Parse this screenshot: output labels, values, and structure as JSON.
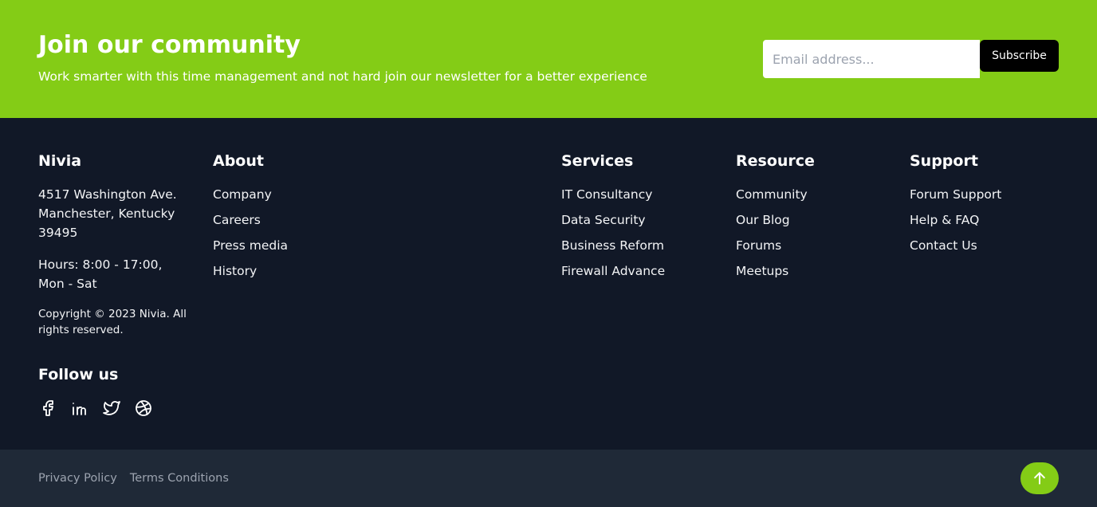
{
  "newsletter": {
    "title": "Join our community",
    "subtitle": "Work smarter with this time management and not hard join our newsletter for a better experience",
    "email_placeholder": "Email address...",
    "subscribe_label": "Subscribe"
  },
  "brand": {
    "name": "Nivia",
    "address_line1": "4517 Washington Ave.",
    "address_line2": "Manchester, Kentucky",
    "address_line3": "39495",
    "hours_line1": "Hours: 8:00 - 17:00,",
    "hours_line2": "Mon - Sat",
    "copyright": "Copyright © 2023 Nivia. All rights reserved.",
    "follow_title": "Follow us",
    "socials": [
      "facebook-icon",
      "linkedin-icon",
      "twitter-icon",
      "dribbble-icon"
    ]
  },
  "columns": {
    "about": {
      "title": "About",
      "links": [
        "Company",
        "Careers",
        "Press media",
        "History"
      ]
    },
    "services": {
      "title": "Services",
      "links": [
        "IT Consultancy",
        "Data Security",
        "Business Reform",
        "Firewall Advance"
      ]
    },
    "resource": {
      "title": "Resource",
      "links": [
        "Community",
        "Our Blog",
        "Forums",
        "Meetups"
      ]
    },
    "support": {
      "title": "Support",
      "links": [
        "Forum Support",
        "Help & FAQ",
        "Contact Us"
      ]
    }
  },
  "bottom": {
    "privacy": "Privacy Policy",
    "terms": "Terms Conditions",
    "scroll_top_icon": "arrow-up-icon"
  },
  "colors": {
    "accent": "#84cc16",
    "footer_bg": "#111827",
    "bottom_bg": "#1f2937"
  }
}
